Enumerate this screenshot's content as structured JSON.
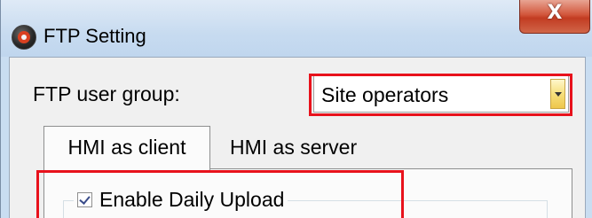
{
  "window": {
    "title": "FTP Setting",
    "close_label": "X"
  },
  "settings": {
    "group_label": "FTP user group:",
    "group_selected": "Site operators"
  },
  "tabs": [
    {
      "label": "HMI as client",
      "active": true
    },
    {
      "label": "HMI as server",
      "active": false
    }
  ],
  "upload": {
    "checkbox_label": "Enable Daily Upload",
    "checked": true
  },
  "highlight_color": "#e8121c",
  "icons": [
    "app-icon",
    "close-icon",
    "dropdown-arrow-icon",
    "checkbox-checked-icon"
  ]
}
